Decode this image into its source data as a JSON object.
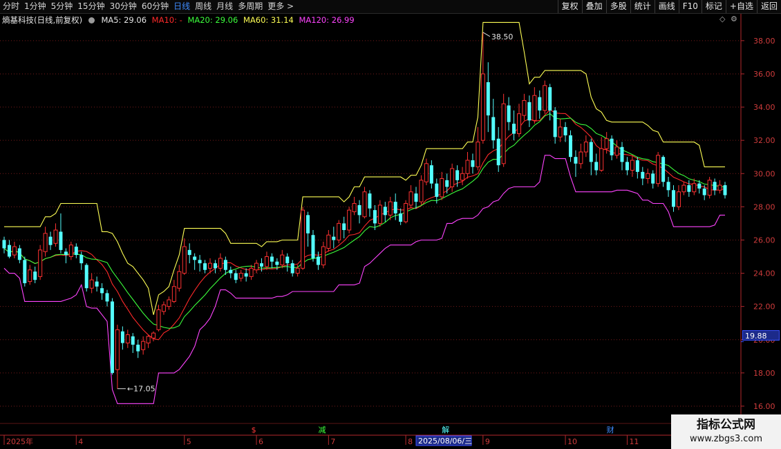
{
  "toolbar": {
    "periods": [
      "分时",
      "1分钟",
      "5分钟",
      "15分钟",
      "30分钟",
      "60分钟",
      "日线",
      "周线",
      "月线",
      "多周期",
      "更多 >"
    ],
    "active_period": "日线",
    "tools": [
      "复权",
      "叠加",
      "多股",
      "统计",
      "画线",
      "F10",
      "标记",
      "+自选",
      "返回"
    ]
  },
  "info": {
    "stock_label": "熵基科技(日线,前复权)",
    "ma5": "MA5: 29.06",
    "ma10": "MA10: -",
    "ma20": "MA20: 29.06",
    "ma60": "MA60: 31.14",
    "ma120": "MA120: 26.99"
  },
  "colors": {
    "up": "#ff3232",
    "down": "#54ffff",
    "ma5": "#ffff00",
    "ma10": "#ff2a2a",
    "ma20": "#3cff3c",
    "ma60": "#ffff55",
    "ma120": "#ff44ff",
    "axis": "#b4282d"
  },
  "chart_data": {
    "type": "candlestick",
    "y_ticks": [
      "16.00",
      "18.00",
      "20.00",
      "22.00",
      "24.00",
      "26.00",
      "28.00",
      "30.00",
      "32.00",
      "34.00",
      "36.00",
      "38.00"
    ],
    "ylim": [
      15.0,
      39.2
    ],
    "current_price": "19.88",
    "max_label": "38.50",
    "min_label": "17.05",
    "x_labels": [
      {
        "text": "2025年",
        "x": 0
      },
      {
        "text": "4",
        "x": 14
      },
      {
        "text": "5",
        "x": 35
      },
      {
        "text": "6",
        "x": 49
      },
      {
        "text": "7",
        "x": 63
      },
      {
        "text": "8",
        "x": 78
      },
      {
        "text": "9",
        "x": 93
      },
      {
        "text": "10",
        "x": 109
      },
      {
        "text": "11",
        "x": 121
      }
    ],
    "cursor_date": "2025/08/06/三",
    "cursor_x": 80,
    "event_marks": [
      {
        "text": "$",
        "x": 48,
        "color": "#ff3a3a"
      },
      {
        "text": "减",
        "x": 61,
        "color": "#3cff3c"
      },
      {
        "text": "解",
        "x": 85,
        "color": "#54ffff"
      },
      {
        "text": "财",
        "x": 117,
        "color": "#3f8cff"
      }
    ],
    "candles": [
      [
        26.0,
        25.5,
        26.2,
        25.2
      ],
      [
        25.7,
        25.0,
        26.0,
        24.9
      ],
      [
        25.1,
        25.6,
        25.9,
        24.9
      ],
      [
        25.5,
        24.8,
        25.7,
        24.6
      ],
      [
        24.8,
        23.4,
        25.0,
        23.2
      ],
      [
        23.5,
        24.2,
        24.5,
        23.3
      ],
      [
        24.1,
        23.6,
        24.4,
        23.4
      ],
      [
        23.8,
        25.4,
        25.7,
        23.6
      ],
      [
        25.3,
        26.4,
        26.8,
        25.0
      ],
      [
        26.2,
        25.7,
        26.5,
        25.4
      ],
      [
        25.8,
        26.6,
        27.0,
        25.6
      ],
      [
        26.5,
        25.4,
        27.6,
        25.2
      ],
      [
        25.3,
        25.1,
        25.5,
        24.6
      ],
      [
        25.0,
        25.7,
        25.9,
        24.8
      ],
      [
        25.6,
        25.1,
        25.8,
        24.9
      ],
      [
        25.1,
        24.6,
        25.3,
        24.2
      ],
      [
        24.5,
        23.1,
        24.6,
        22.9
      ],
      [
        23.1,
        23.6,
        24.0,
        22.8
      ],
      [
        23.5,
        23.2,
        23.8,
        22.9
      ],
      [
        23.1,
        22.8,
        23.4,
        22.4
      ],
      [
        22.8,
        22.3,
        23.0,
        22.0
      ],
      [
        22.3,
        18.0,
        22.5,
        17.9
      ],
      [
        18.2,
        20.6,
        20.9,
        17.05
      ],
      [
        20.5,
        19.8,
        20.8,
        19.4
      ],
      [
        19.8,
        20.3,
        20.6,
        19.5
      ],
      [
        20.2,
        19.7,
        20.4,
        19.2
      ],
      [
        19.7,
        19.3,
        20.0,
        18.9
      ],
      [
        19.4,
        19.9,
        20.2,
        19.1
      ],
      [
        19.8,
        20.2,
        20.3,
        19.5
      ],
      [
        20.1,
        20.4,
        20.5,
        19.9
      ],
      [
        20.6,
        21.8,
        22.1,
        20.5
      ],
      [
        21.7,
        22.1,
        22.3,
        21.5
      ],
      [
        22.0,
        22.4,
        22.6,
        21.8
      ],
      [
        22.3,
        23.2,
        23.6,
        22.2
      ],
      [
        23.1,
        24.1,
        24.5,
        22.9
      ],
      [
        24.0,
        25.6,
        26.1,
        23.9
      ],
      [
        25.4,
        25.1,
        25.8,
        24.6
      ],
      [
        25.0,
        24.8,
        25.2,
        24.2
      ],
      [
        24.8,
        24.6,
        25.1,
        24.1
      ],
      [
        24.6,
        24.2,
        24.8,
        24.0
      ],
      [
        24.3,
        24.6,
        24.9,
        24.0
      ],
      [
        24.6,
        24.3,
        24.8,
        24.0
      ],
      [
        24.3,
        24.9,
        25.2,
        24.1
      ],
      [
        24.8,
        24.2,
        25.0,
        23.9
      ],
      [
        24.2,
        24.0,
        24.4,
        23.7
      ],
      [
        24.0,
        23.6,
        24.2,
        23.4
      ],
      [
        23.7,
        24.0,
        24.2,
        23.5
      ],
      [
        24.0,
        23.8,
        24.3,
        23.5
      ],
      [
        23.8,
        24.3,
        24.5,
        23.6
      ],
      [
        24.2,
        24.6,
        24.8,
        24.0
      ],
      [
        24.6,
        24.4,
        24.9,
        24.1
      ],
      [
        24.4,
        25.0,
        25.3,
        24.2
      ],
      [
        25.0,
        24.7,
        25.2,
        24.3
      ],
      [
        24.7,
        24.5,
        24.9,
        24.2
      ],
      [
        24.5,
        25.1,
        25.4,
        24.3
      ],
      [
        25.0,
        24.6,
        25.2,
        24.1
      ],
      [
        24.6,
        24.0,
        24.8,
        23.8
      ],
      [
        24.0,
        24.3,
        24.5,
        23.8
      ],
      [
        24.3,
        27.8,
        28.0,
        24.2
      ],
      [
        27.5,
        26.4,
        27.7,
        25.6
      ],
      [
        26.3,
        24.9,
        26.6,
        24.7
      ],
      [
        25.0,
        24.5,
        25.3,
        24.2
      ],
      [
        24.5,
        25.6,
        25.9,
        24.3
      ],
      [
        25.5,
        26.3,
        26.6,
        25.3
      ],
      [
        26.2,
        26.0,
        26.8,
        25.5
      ],
      [
        26.0,
        27.0,
        27.2,
        25.8
      ],
      [
        27.0,
        26.6,
        27.4,
        26.1
      ],
      [
        26.6,
        27.8,
        28.0,
        26.4
      ],
      [
        27.7,
        28.2,
        28.6,
        27.5
      ],
      [
        28.1,
        27.5,
        28.4,
        27.0
      ],
      [
        27.4,
        28.9,
        29.2,
        27.3
      ],
      [
        28.8,
        27.9,
        29.0,
        27.4
      ],
      [
        27.8,
        27.0,
        28.1,
        26.6
      ],
      [
        27.0,
        28.1,
        28.4,
        26.8
      ],
      [
        28.0,
        27.5,
        28.3,
        27.1
      ],
      [
        27.5,
        28.3,
        28.6,
        27.2
      ],
      [
        28.3,
        27.6,
        28.8,
        27.2
      ],
      [
        27.6,
        27.1,
        27.9,
        26.9
      ],
      [
        27.1,
        28.2,
        28.4,
        27.0
      ],
      [
        28.1,
        28.9,
        29.3,
        27.9
      ],
      [
        28.8,
        28.3,
        29.2,
        27.9
      ],
      [
        28.3,
        29.6,
        29.9,
        28.1
      ],
      [
        29.5,
        30.6,
        30.9,
        29.3
      ],
      [
        30.5,
        29.4,
        30.8,
        29.1
      ],
      [
        29.4,
        28.6,
        29.7,
        28.2
      ],
      [
        28.6,
        29.7,
        30.1,
        28.4
      ],
      [
        29.6,
        29.2,
        30.0,
        28.8
      ],
      [
        29.2,
        30.3,
        30.6,
        28.9
      ],
      [
        30.2,
        29.6,
        30.5,
        29.2
      ],
      [
        29.6,
        30.0,
        30.4,
        29.3
      ],
      [
        30.0,
        30.8,
        31.3,
        29.7
      ],
      [
        30.8,
        30.4,
        31.2,
        30.0
      ],
      [
        30.4,
        31.9,
        32.8,
        30.2
      ],
      [
        32.0,
        36.0,
        38.5,
        31.8
      ],
      [
        35.5,
        33.5,
        36.7,
        32.5
      ],
      [
        33.4,
        32.0,
        34.5,
        31.5
      ],
      [
        32.1,
        30.5,
        32.8,
        30.1
      ],
      [
        30.6,
        34.2,
        34.8,
        30.4
      ],
      [
        34.1,
        33.1,
        34.6,
        32.6
      ],
      [
        33.0,
        32.4,
        33.8,
        32.0
      ],
      [
        32.4,
        33.6,
        34.2,
        32.2
      ],
      [
        33.5,
        34.4,
        34.8,
        33.2
      ],
      [
        34.3,
        33.2,
        34.7,
        32.8
      ],
      [
        33.2,
        34.7,
        35.2,
        33.0
      ],
      [
        34.6,
        33.8,
        35.0,
        33.3
      ],
      [
        33.8,
        35.3,
        35.6,
        33.6
      ],
      [
        35.2,
        33.8,
        35.4,
        33.2
      ],
      [
        33.8,
        32.2,
        34.0,
        31.8
      ],
      [
        32.2,
        32.8,
        33.3,
        31.9
      ],
      [
        32.8,
        32.3,
        33.1,
        31.9
      ],
      [
        32.3,
        31.0,
        32.6,
        30.7
      ],
      [
        31.0,
        30.6,
        31.4,
        29.8
      ],
      [
        30.6,
        31.3,
        31.8,
        30.3
      ],
      [
        31.3,
        31.9,
        32.3,
        31.0
      ],
      [
        31.9,
        30.7,
        32.1,
        29.9
      ],
      [
        30.7,
        30.2,
        31.2,
        29.9
      ],
      [
        30.2,
        31.5,
        32.2,
        30.1
      ],
      [
        31.5,
        32.1,
        32.5,
        31.2
      ],
      [
        32.1,
        31.1,
        32.3,
        30.8
      ],
      [
        31.1,
        31.6,
        32.0,
        30.9
      ],
      [
        31.6,
        30.7,
        31.9,
        30.2
      ],
      [
        30.7,
        30.2,
        31.0,
        29.9
      ],
      [
        30.2,
        30.8,
        31.1,
        29.8
      ],
      [
        30.8,
        30.1,
        31.0,
        29.7
      ],
      [
        30.1,
        29.7,
        30.4,
        29.3
      ],
      [
        29.7,
        30.0,
        30.3,
        29.4
      ],
      [
        30.0,
        29.4,
        30.2,
        29.1
      ],
      [
        29.4,
        31.1,
        31.3,
        29.2
      ],
      [
        31.0,
        29.5,
        31.1,
        29.2
      ],
      [
        29.5,
        29.0,
        29.8,
        28.6
      ],
      [
        29.0,
        28.0,
        29.3,
        27.7
      ],
      [
        28.0,
        28.9,
        29.3,
        27.8
      ],
      [
        28.9,
        29.3,
        29.5,
        28.7
      ],
      [
        29.3,
        28.9,
        29.6,
        28.6
      ],
      [
        28.9,
        29.4,
        29.7,
        28.7
      ],
      [
        29.4,
        29.1,
        29.6,
        28.8
      ],
      [
        29.1,
        28.7,
        29.3,
        28.4
      ],
      [
        28.7,
        29.6,
        29.8,
        28.5
      ],
      [
        29.5,
        29.0,
        29.7,
        28.7
      ],
      [
        29.0,
        29.3,
        29.6,
        28.8
      ],
      [
        29.3,
        28.7,
        29.5,
        28.5
      ]
    ]
  },
  "overlay_icons": [
    "diamond-icon",
    "settings-icon"
  ],
  "watermark": {
    "line1": "指标公式网",
    "line2": "www.zbgs3.com"
  }
}
